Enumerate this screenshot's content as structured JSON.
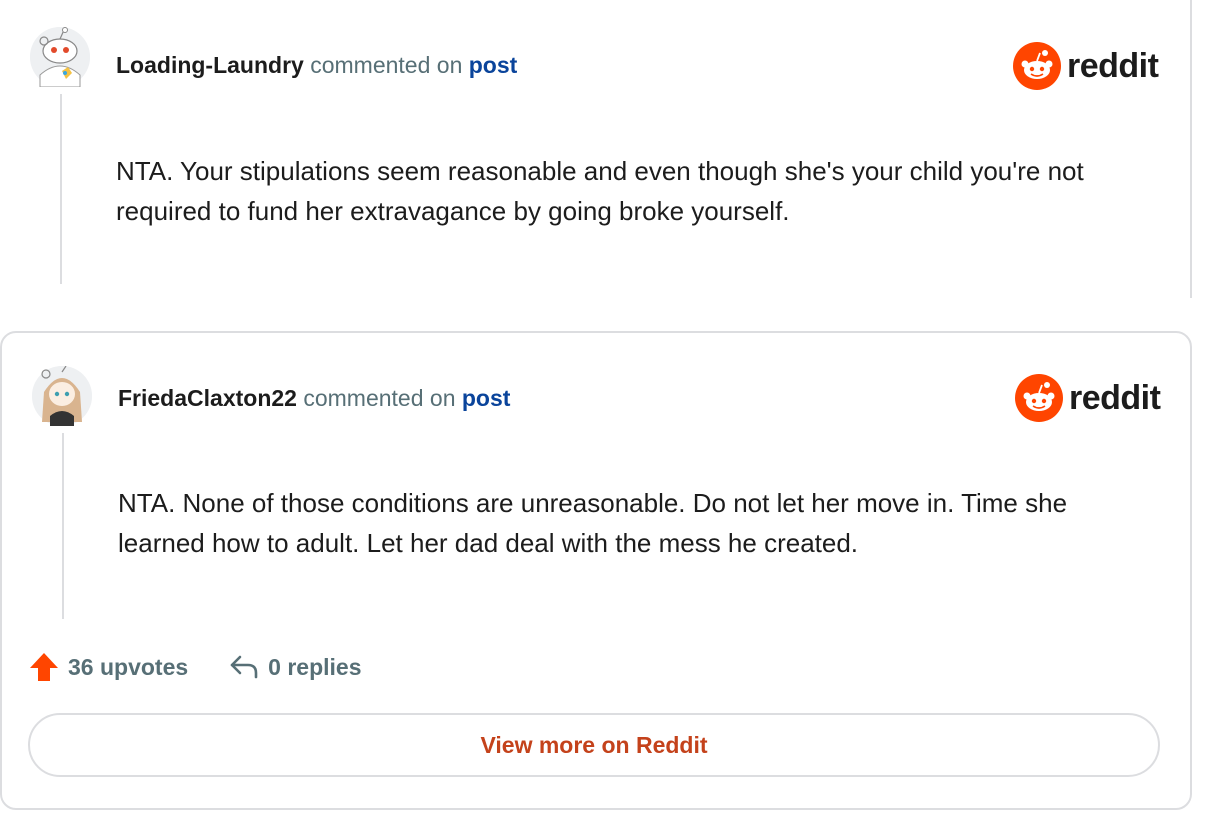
{
  "comments": [
    {
      "username": "Loading-Laundry",
      "action": "commented on",
      "link": "post",
      "body": "NTA. Your stipulations seem reasonable and even though she's your child you're not required to fund her extravagance by going broke yourself."
    },
    {
      "username": "FriedaClaxton22",
      "action": "commented on",
      "link": "post",
      "body": "NTA. None of those conditions are unreasonable. Do not let her move in. Time she learned how to adult. Let her dad deal with the mess he created."
    }
  ],
  "brand": {
    "name": "reddit",
    "icon": "reddit-snoo-icon",
    "color": "#ff4500"
  },
  "stats": {
    "upvotes": "36 upvotes",
    "replies": "0 replies"
  },
  "view_more_label": "View more on Reddit",
  "colors": {
    "accent": "#ff4500",
    "link": "#0a449b",
    "muted": "#576f76",
    "cta": "#c4421b"
  }
}
